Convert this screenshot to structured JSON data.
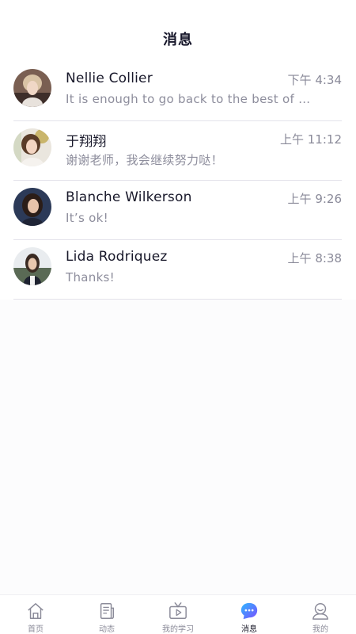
{
  "header": {
    "title": "消息"
  },
  "conversations": [
    {
      "name": "Nellie Collier",
      "time": "下午 4:34",
      "preview": "It is enough to go back to the best of …"
    },
    {
      "name": "于翔翔",
      "time": "上午 11:12",
      "preview": "谢谢老师，我会继续努力哒！"
    },
    {
      "name": "Blanche Wilkerson",
      "time": "上午 9:26",
      "preview": "It’s ok!"
    },
    {
      "name": "Lida Rodriquez",
      "time": "上午 8:38",
      "preview": "Thanks!"
    }
  ],
  "tabbar": {
    "items": [
      {
        "label": "首页",
        "icon": "home-icon"
      },
      {
        "label": "动态",
        "icon": "news-icon"
      },
      {
        "label": "我的学习",
        "icon": "tv-play-icon"
      },
      {
        "label": "消息",
        "icon": "chat-bubble-icon",
        "active": true
      },
      {
        "label": "我的",
        "icon": "profile-icon"
      }
    ]
  },
  "colors": {
    "accent_gradient_start": "#2fb8ff",
    "accent_gradient_end": "#7a4dff",
    "divider": "#e3e2ea",
    "secondary_text": "#8d8d9c"
  }
}
